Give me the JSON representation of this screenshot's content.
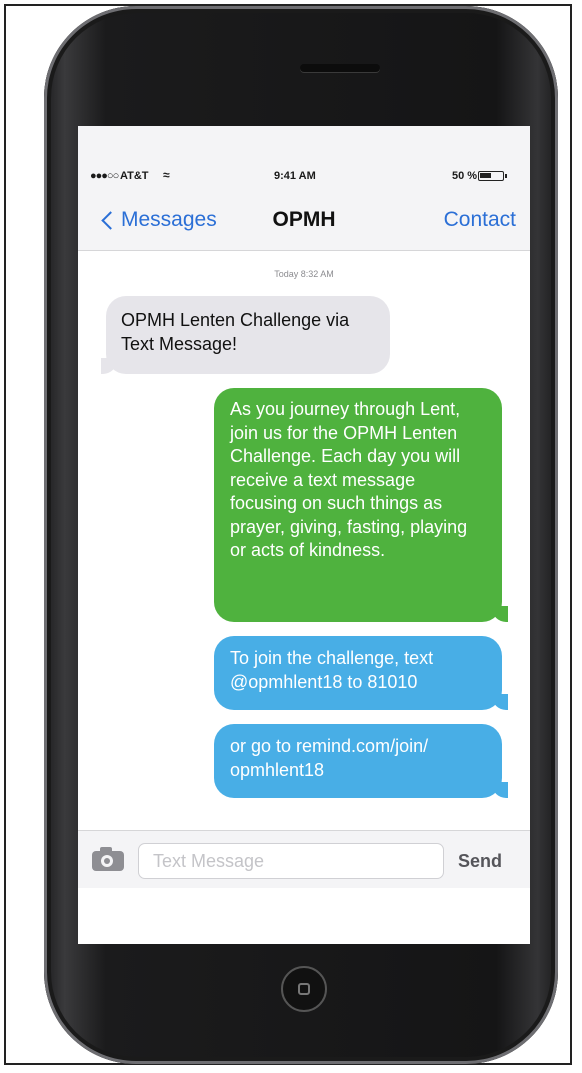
{
  "status_bar": {
    "signal": "●●●○○",
    "carrier": "AT&T",
    "wifi_icon": "wifi-icon",
    "time": "9:41 AM",
    "battery_percent": "50 %",
    "battery_level": 0.5
  },
  "nav": {
    "back_label": "Messages",
    "title": "OPMH",
    "contact_label": "Contact"
  },
  "conversation": {
    "timestamp": "Today 8:32 AM",
    "messages": [
      {
        "direction": "incoming",
        "text": "OPMH Lenten Challenge via Text Message!",
        "color": "#e6e5ea"
      },
      {
        "direction": "outgoing",
        "text": "As you journey through Lent, join us for the OPMH Lenten Challenge. Each day you will receive a text message focusing on such things as prayer, giving, fasting, playing or acts of kindness.",
        "color": "#4fb23e"
      },
      {
        "direction": "outgoing",
        "text": "To join the challenge, text @opmhlent18 to 81010",
        "color": "#48aee6"
      },
      {
        "direction": "outgoing",
        "text": "or go to remind.com/join/ opmhlent18",
        "color": "#48aee6"
      }
    ]
  },
  "composer": {
    "camera_icon": "camera-icon",
    "placeholder": "Text Message",
    "value": "",
    "send_label": "Send"
  },
  "colors": {
    "ios_blue": "#2b6fd6",
    "green_bubble": "#4fb23e",
    "blue_bubble": "#48aee6",
    "gray_bubble": "#e6e5ea"
  }
}
